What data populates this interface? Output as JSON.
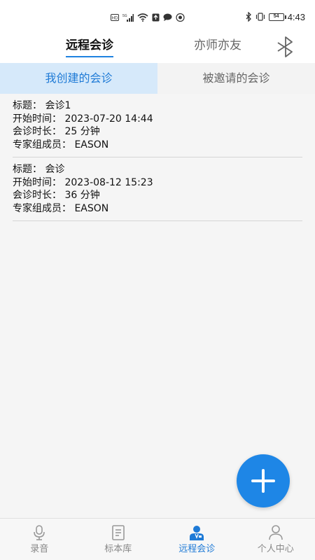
{
  "status_bar": {
    "time": "4:43",
    "battery": "54",
    "left_icons": [
      "hd-icon",
      "signal-icon",
      "wifi-icon",
      "notification-icon",
      "chat-icon",
      "camera-icon"
    ],
    "right_icons": [
      "bluetooth-icon",
      "vibrate-icon",
      "battery-icon"
    ]
  },
  "top_tabs": {
    "active": "远程会诊",
    "inactive": "亦师亦友",
    "accent_color": "#1e82e0"
  },
  "sub_tabs": {
    "active": "我创建的会诊",
    "inactive": "被邀请的会诊"
  },
  "consultations": [
    {
      "title": "标题：  会诊1",
      "start": "开始时间：  2023-07-20 14:44",
      "duration": "会诊时长：  25 分钟",
      "members": "专家组成员：  EASON"
    },
    {
      "title": "标题：  会诊",
      "start": "开始时间：  2023-08-12 15:23",
      "duration": "会诊时长：  36 分钟",
      "members": "专家组成员：  EASON"
    }
  ],
  "fab": {
    "icon": "plus-icon",
    "color": "#1e86e6"
  },
  "bottom_nav": [
    {
      "label": "录音",
      "icon": "microphone-icon",
      "active": false
    },
    {
      "label": "标本库",
      "icon": "document-icon",
      "active": false
    },
    {
      "label": "远程会诊",
      "icon": "doctor-icon",
      "active": true
    },
    {
      "label": "个人中心",
      "icon": "person-icon",
      "active": false
    }
  ]
}
